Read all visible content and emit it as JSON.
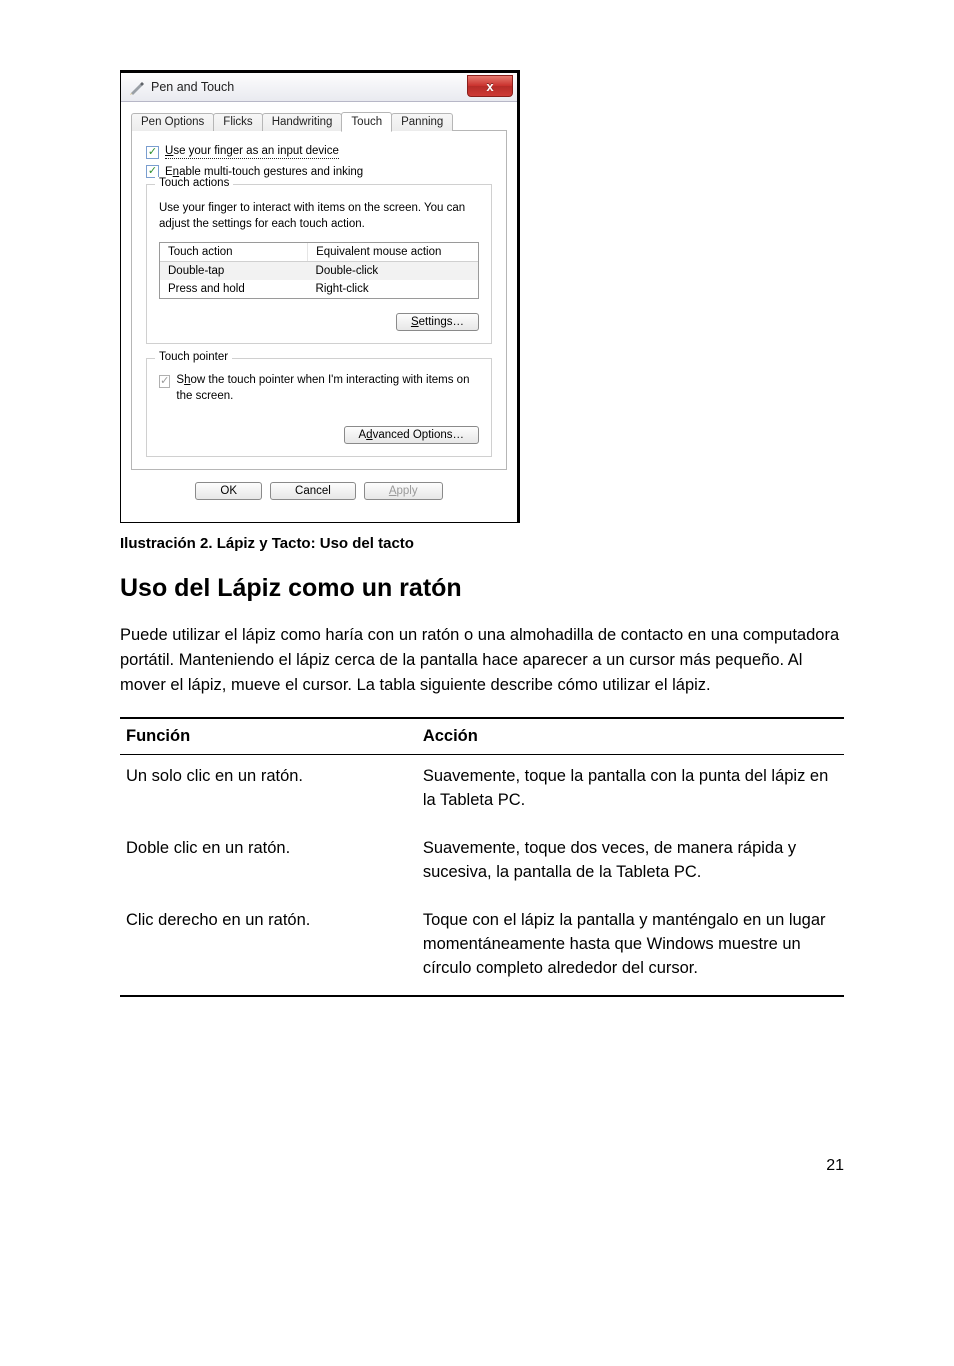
{
  "dialog": {
    "title": "Pen and Touch",
    "close_glyph": "x",
    "tabs": [
      "Pen Options",
      "Flicks",
      "Handwriting",
      "Touch",
      "Panning"
    ],
    "active_tab_index": 3,
    "checkbox1": {
      "prefix_char": "U",
      "rest": "se your finger as an input device",
      "checked": true
    },
    "checkbox2": {
      "prefix": "E",
      "underline_char": "n",
      "rest": "able multi-touch gestures and inking",
      "checked": true
    },
    "touch_actions": {
      "legend": "Touch actions",
      "desc": "Use your finger to interact with items on the screen. You can adjust the settings for each touch action.",
      "headers": [
        "Touch action",
        "Equivalent mouse action"
      ],
      "rows": [
        {
          "action": "Double-tap",
          "equiv": "Double-click"
        },
        {
          "action": "Press and hold",
          "equiv": "Right-click"
        }
      ],
      "settings_btn": {
        "underline_char": "S",
        "rest": "ettings…"
      }
    },
    "touch_pointer": {
      "legend": "Touch pointer",
      "chk": {
        "prefix": "S",
        "underline_char": "h",
        "rest": "ow the touch pointer when I'm interacting with items on the screen.",
        "checked": true,
        "disabled": true
      },
      "advanced_btn": {
        "prefix": "A",
        "underline_char": "d",
        "rest": "vanced Options…"
      }
    },
    "buttons": {
      "ok": "OK",
      "cancel": "Cancel",
      "apply": {
        "underline_char": "A",
        "rest": "pply"
      }
    }
  },
  "caption": "Ilustración 2. Lápiz y Tacto: Uso del tacto",
  "heading": "Uso del Lápiz como un ratón",
  "paragraph": "Puede utilizar el lápiz como haría con un ratón o una almohadilla de contacto en una computadora portátil. Manteniendo el lápiz cerca de la pantalla hace aparecer a un cursor más pequeño. Al mover el lápiz, mueve el cursor. La tabla siguiente describe cómo utilizar el lápiz.",
  "doc_table": {
    "headers": [
      "Función",
      "Acción"
    ],
    "rows": [
      {
        "func": "Un solo clic en un ratón.",
        "action": "Suavemente, toque la pantalla con la punta del lápiz en la Tableta PC."
      },
      {
        "func": "Doble clic en un ratón.",
        "action": "Suavemente, toque dos veces, de manera rápida y sucesiva, la pantalla de la Tableta PC."
      },
      {
        "func": "Clic derecho en un ratón.",
        "action": "Toque con el lápiz la pantalla y manténgalo en un lugar momentáneamente hasta que Windows muestre un círculo completo alrededor del cursor."
      }
    ]
  },
  "page_number": "21"
}
